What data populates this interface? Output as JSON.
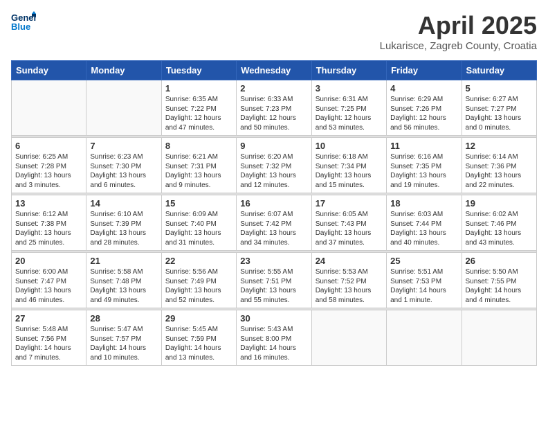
{
  "header": {
    "logo_line1": "General",
    "logo_line2": "Blue",
    "month": "April 2025",
    "location": "Lukarisce, Zagreb County, Croatia"
  },
  "weekdays": [
    "Sunday",
    "Monday",
    "Tuesday",
    "Wednesday",
    "Thursday",
    "Friday",
    "Saturday"
  ],
  "weeks": [
    [
      {
        "day": "",
        "info": ""
      },
      {
        "day": "",
        "info": ""
      },
      {
        "day": "1",
        "info": "Sunrise: 6:35 AM\nSunset: 7:22 PM\nDaylight: 12 hours\nand 47 minutes."
      },
      {
        "day": "2",
        "info": "Sunrise: 6:33 AM\nSunset: 7:23 PM\nDaylight: 12 hours\nand 50 minutes."
      },
      {
        "day": "3",
        "info": "Sunrise: 6:31 AM\nSunset: 7:25 PM\nDaylight: 12 hours\nand 53 minutes."
      },
      {
        "day": "4",
        "info": "Sunrise: 6:29 AM\nSunset: 7:26 PM\nDaylight: 12 hours\nand 56 minutes."
      },
      {
        "day": "5",
        "info": "Sunrise: 6:27 AM\nSunset: 7:27 PM\nDaylight: 13 hours\nand 0 minutes."
      }
    ],
    [
      {
        "day": "6",
        "info": "Sunrise: 6:25 AM\nSunset: 7:28 PM\nDaylight: 13 hours\nand 3 minutes."
      },
      {
        "day": "7",
        "info": "Sunrise: 6:23 AM\nSunset: 7:30 PM\nDaylight: 13 hours\nand 6 minutes."
      },
      {
        "day": "8",
        "info": "Sunrise: 6:21 AM\nSunset: 7:31 PM\nDaylight: 13 hours\nand 9 minutes."
      },
      {
        "day": "9",
        "info": "Sunrise: 6:20 AM\nSunset: 7:32 PM\nDaylight: 13 hours\nand 12 minutes."
      },
      {
        "day": "10",
        "info": "Sunrise: 6:18 AM\nSunset: 7:34 PM\nDaylight: 13 hours\nand 15 minutes."
      },
      {
        "day": "11",
        "info": "Sunrise: 6:16 AM\nSunset: 7:35 PM\nDaylight: 13 hours\nand 19 minutes."
      },
      {
        "day": "12",
        "info": "Sunrise: 6:14 AM\nSunset: 7:36 PM\nDaylight: 13 hours\nand 22 minutes."
      }
    ],
    [
      {
        "day": "13",
        "info": "Sunrise: 6:12 AM\nSunset: 7:38 PM\nDaylight: 13 hours\nand 25 minutes."
      },
      {
        "day": "14",
        "info": "Sunrise: 6:10 AM\nSunset: 7:39 PM\nDaylight: 13 hours\nand 28 minutes."
      },
      {
        "day": "15",
        "info": "Sunrise: 6:09 AM\nSunset: 7:40 PM\nDaylight: 13 hours\nand 31 minutes."
      },
      {
        "day": "16",
        "info": "Sunrise: 6:07 AM\nSunset: 7:42 PM\nDaylight: 13 hours\nand 34 minutes."
      },
      {
        "day": "17",
        "info": "Sunrise: 6:05 AM\nSunset: 7:43 PM\nDaylight: 13 hours\nand 37 minutes."
      },
      {
        "day": "18",
        "info": "Sunrise: 6:03 AM\nSunset: 7:44 PM\nDaylight: 13 hours\nand 40 minutes."
      },
      {
        "day": "19",
        "info": "Sunrise: 6:02 AM\nSunset: 7:46 PM\nDaylight: 13 hours\nand 43 minutes."
      }
    ],
    [
      {
        "day": "20",
        "info": "Sunrise: 6:00 AM\nSunset: 7:47 PM\nDaylight: 13 hours\nand 46 minutes."
      },
      {
        "day": "21",
        "info": "Sunrise: 5:58 AM\nSunset: 7:48 PM\nDaylight: 13 hours\nand 49 minutes."
      },
      {
        "day": "22",
        "info": "Sunrise: 5:56 AM\nSunset: 7:49 PM\nDaylight: 13 hours\nand 52 minutes."
      },
      {
        "day": "23",
        "info": "Sunrise: 5:55 AM\nSunset: 7:51 PM\nDaylight: 13 hours\nand 55 minutes."
      },
      {
        "day": "24",
        "info": "Sunrise: 5:53 AM\nSunset: 7:52 PM\nDaylight: 13 hours\nand 58 minutes."
      },
      {
        "day": "25",
        "info": "Sunrise: 5:51 AM\nSunset: 7:53 PM\nDaylight: 14 hours\nand 1 minute."
      },
      {
        "day": "26",
        "info": "Sunrise: 5:50 AM\nSunset: 7:55 PM\nDaylight: 14 hours\nand 4 minutes."
      }
    ],
    [
      {
        "day": "27",
        "info": "Sunrise: 5:48 AM\nSunset: 7:56 PM\nDaylight: 14 hours\nand 7 minutes."
      },
      {
        "day": "28",
        "info": "Sunrise: 5:47 AM\nSunset: 7:57 PM\nDaylight: 14 hours\nand 10 minutes."
      },
      {
        "day": "29",
        "info": "Sunrise: 5:45 AM\nSunset: 7:59 PM\nDaylight: 14 hours\nand 13 minutes."
      },
      {
        "day": "30",
        "info": "Sunrise: 5:43 AM\nSunset: 8:00 PM\nDaylight: 14 hours\nand 16 minutes."
      },
      {
        "day": "",
        "info": ""
      },
      {
        "day": "",
        "info": ""
      },
      {
        "day": "",
        "info": ""
      }
    ]
  ]
}
